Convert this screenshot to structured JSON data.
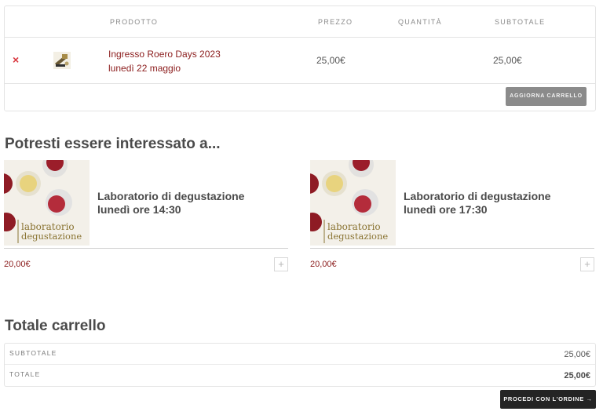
{
  "cart": {
    "headers": {
      "product": "PRODOTTO",
      "price": "PREZZO",
      "quantity": "QUANTITÀ",
      "subtotal": "SUBTOTALE"
    },
    "items": [
      {
        "remove_icon": "×",
        "name_line1": "Ingresso Roero Days 2023",
        "name_line2": "lunedì 22 maggio",
        "price": "25,00€",
        "subtotal": "25,00€"
      }
    ],
    "update_label": "AGGIORNA CARRELLO"
  },
  "cross_sells": {
    "title": "Potresti essere interessato a...",
    "image_caption_line1": "laboratorio",
    "image_caption_line2": "degustazione",
    "products": [
      {
        "title_line1": "Laboratorio di degustazione",
        "title_line2": "lunedì ore 14:30",
        "price": "20,00€",
        "add_icon": "+"
      },
      {
        "title_line1": "Laboratorio di degustazione",
        "title_line2": "lunedì ore 17:30",
        "price": "20,00€",
        "add_icon": "+"
      }
    ]
  },
  "totals": {
    "title": "Totale carrello",
    "subtotal_label": "SUBTOTALE",
    "subtotal_value": "25,00€",
    "total_label": "TOTALE",
    "total_value": "25,00€",
    "checkout_label": "PROCEDI CON L'ORDINE →"
  },
  "colors": {
    "accent": "#8b1c1c",
    "remove": "#d9363e",
    "button_gray": "#8b8b8b",
    "button_dark": "#242424"
  }
}
